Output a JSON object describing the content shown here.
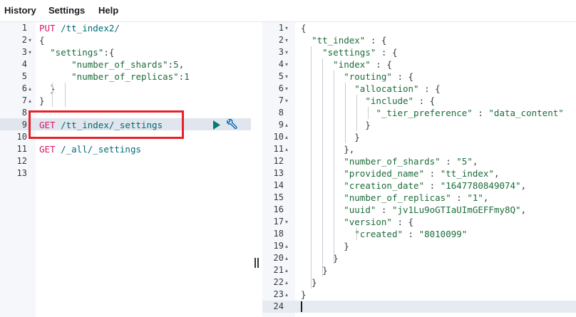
{
  "menu": {
    "history": "History",
    "settings": "Settings",
    "help": "Help"
  },
  "request_editor": {
    "lines": [
      {
        "num": "1",
        "fold": "",
        "tokens": [
          [
            "method",
            "PUT"
          ],
          [
            "punct",
            " "
          ],
          [
            "url",
            "/tt_index2/"
          ]
        ]
      },
      {
        "num": "2",
        "fold": "▾",
        "tokens": [
          [
            "punct",
            "{"
          ]
        ]
      },
      {
        "num": "3",
        "fold": "▾",
        "tokens": [
          [
            "punct",
            "  "
          ],
          [
            "str",
            "\"settings\""
          ],
          [
            "punct",
            ":{"
          ]
        ]
      },
      {
        "num": "4",
        "fold": "",
        "tokens": [
          [
            "punct",
            "      "
          ],
          [
            "str",
            "\"number_of_shards\""
          ],
          [
            "punct",
            ":"
          ],
          [
            "num",
            "5"
          ],
          [
            "punct",
            ","
          ]
        ]
      },
      {
        "num": "5",
        "fold": "",
        "tokens": [
          [
            "punct",
            "      "
          ],
          [
            "str",
            "\"number_of_replicas\""
          ],
          [
            "punct",
            ":"
          ],
          [
            "num",
            "1"
          ]
        ]
      },
      {
        "num": "6",
        "fold": "▴",
        "tokens": [
          [
            "punct",
            "  }"
          ]
        ]
      },
      {
        "num": "7",
        "fold": "▴",
        "tokens": [
          [
            "punct",
            "}"
          ]
        ]
      },
      {
        "num": "8",
        "fold": "",
        "tokens": []
      },
      {
        "num": "9",
        "fold": "",
        "tokens": [
          [
            "method",
            "GET"
          ],
          [
            "punct",
            " "
          ],
          [
            "url",
            "/tt_index/_settings"
          ]
        ]
      },
      {
        "num": "10",
        "fold": "",
        "tokens": []
      },
      {
        "num": "11",
        "fold": "",
        "tokens": [
          [
            "method",
            "GET"
          ],
          [
            "punct",
            " "
          ],
          [
            "url",
            "/_all/_settings"
          ]
        ]
      },
      {
        "num": "12",
        "fold": "",
        "tokens": []
      },
      {
        "num": "13",
        "fold": "",
        "tokens": []
      }
    ]
  },
  "response_viewer": {
    "lines": [
      {
        "num": "1",
        "fold": "▾",
        "tokens": [
          [
            "punct",
            "{"
          ]
        ]
      },
      {
        "num": "2",
        "fold": "▾",
        "tokens": [
          [
            "punct",
            "  "
          ],
          [
            "str",
            "\"tt_index\""
          ],
          [
            "punct",
            " : {"
          ]
        ]
      },
      {
        "num": "3",
        "fold": "▾",
        "tokens": [
          [
            "punct",
            "    "
          ],
          [
            "str",
            "\"settings\""
          ],
          [
            "punct",
            " : {"
          ]
        ]
      },
      {
        "num": "4",
        "fold": "▾",
        "tokens": [
          [
            "punct",
            "      "
          ],
          [
            "str",
            "\"index\""
          ],
          [
            "punct",
            " : {"
          ]
        ]
      },
      {
        "num": "5",
        "fold": "▾",
        "tokens": [
          [
            "punct",
            "        "
          ],
          [
            "str",
            "\"routing\""
          ],
          [
            "punct",
            " : {"
          ]
        ]
      },
      {
        "num": "6",
        "fold": "▾",
        "tokens": [
          [
            "punct",
            "          "
          ],
          [
            "str",
            "\"allocation\""
          ],
          [
            "punct",
            " : {"
          ]
        ]
      },
      {
        "num": "7",
        "fold": "▾",
        "tokens": [
          [
            "punct",
            "            "
          ],
          [
            "str",
            "\"include\""
          ],
          [
            "punct",
            " : {"
          ]
        ]
      },
      {
        "num": "8",
        "fold": "",
        "tokens": [
          [
            "punct",
            "              "
          ],
          [
            "str",
            "\"_tier_preference\""
          ],
          [
            "punct",
            " : "
          ],
          [
            "num",
            "\"data_content\""
          ]
        ]
      },
      {
        "num": "9",
        "fold": "▴",
        "tokens": [
          [
            "punct",
            "            }"
          ]
        ]
      },
      {
        "num": "10",
        "fold": "▴",
        "tokens": [
          [
            "punct",
            "          }"
          ]
        ]
      },
      {
        "num": "11",
        "fold": "▴",
        "tokens": [
          [
            "punct",
            "        },"
          ]
        ]
      },
      {
        "num": "12",
        "fold": "",
        "tokens": [
          [
            "punct",
            "        "
          ],
          [
            "str",
            "\"number_of_shards\""
          ],
          [
            "punct",
            " : "
          ],
          [
            "num",
            "\"5\""
          ],
          [
            "punct",
            ","
          ]
        ]
      },
      {
        "num": "13",
        "fold": "",
        "tokens": [
          [
            "punct",
            "        "
          ],
          [
            "str",
            "\"provided_name\""
          ],
          [
            "punct",
            " : "
          ],
          [
            "num",
            "\"tt_index\""
          ],
          [
            "punct",
            ","
          ]
        ]
      },
      {
        "num": "14",
        "fold": "",
        "tokens": [
          [
            "punct",
            "        "
          ],
          [
            "str",
            "\"creation_date\""
          ],
          [
            "punct",
            " : "
          ],
          [
            "num",
            "\"1647780849074\""
          ],
          [
            "punct",
            ","
          ]
        ]
      },
      {
        "num": "15",
        "fold": "",
        "tokens": [
          [
            "punct",
            "        "
          ],
          [
            "str",
            "\"number_of_replicas\""
          ],
          [
            "punct",
            " : "
          ],
          [
            "num",
            "\"1\""
          ],
          [
            "punct",
            ","
          ]
        ]
      },
      {
        "num": "16",
        "fold": "",
        "tokens": [
          [
            "punct",
            "        "
          ],
          [
            "str",
            "\"uuid\""
          ],
          [
            "punct",
            " : "
          ],
          [
            "num",
            "\"jv1Lu9oGTIaUImGEFFmy8Q\""
          ],
          [
            "punct",
            ","
          ]
        ]
      },
      {
        "num": "17",
        "fold": "▾",
        "tokens": [
          [
            "punct",
            "        "
          ],
          [
            "str",
            "\"version\""
          ],
          [
            "punct",
            " : {"
          ]
        ]
      },
      {
        "num": "18",
        "fold": "",
        "tokens": [
          [
            "punct",
            "          "
          ],
          [
            "str",
            "\"created\""
          ],
          [
            "punct",
            " : "
          ],
          [
            "num",
            "\"8010099\""
          ]
        ]
      },
      {
        "num": "19",
        "fold": "▴",
        "tokens": [
          [
            "punct",
            "        }"
          ]
        ]
      },
      {
        "num": "20",
        "fold": "▴",
        "tokens": [
          [
            "punct",
            "      }"
          ]
        ]
      },
      {
        "num": "21",
        "fold": "▴",
        "tokens": [
          [
            "punct",
            "    }"
          ]
        ]
      },
      {
        "num": "22",
        "fold": "▴",
        "tokens": [
          [
            "punct",
            "  }"
          ]
        ]
      },
      {
        "num": "23",
        "fold": "▴",
        "tokens": [
          [
            "punct",
            "}"
          ]
        ]
      },
      {
        "num": "24",
        "fold": "",
        "tokens": []
      }
    ]
  },
  "icons": {
    "run": "play-icon",
    "actions": "wrench-icon",
    "resize": "pane-resize-handle"
  },
  "colors": {
    "method": "#d11a6a",
    "url": "#006a75",
    "string": "#1b6c3a",
    "highlight_box": "#e7212b",
    "run_button": "#017d73",
    "actions_icon": "#006bb8"
  }
}
